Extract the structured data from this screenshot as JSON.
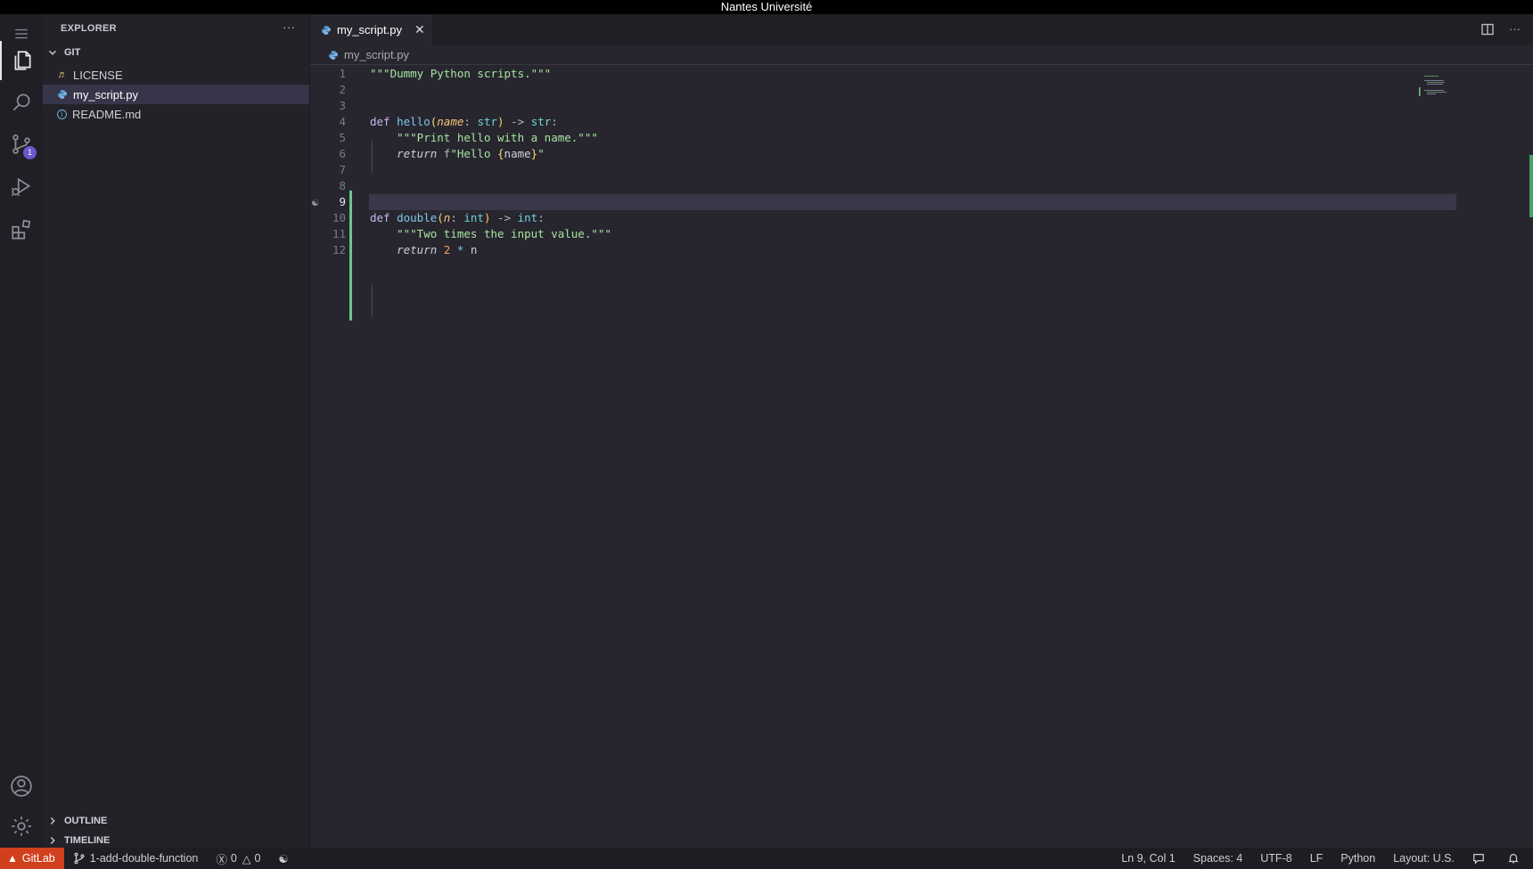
{
  "window": {
    "title": "Nantes Université"
  },
  "activity_bar": {
    "items": [
      {
        "name": "explorer",
        "icon": "files-icon"
      },
      {
        "name": "search",
        "icon": "search-icon"
      },
      {
        "name": "source-control",
        "icon": "source-control-icon",
        "badge": "1"
      },
      {
        "name": "run-debug",
        "icon": "run-debug-icon"
      },
      {
        "name": "extensions",
        "icon": "extensions-icon"
      }
    ]
  },
  "sidebar": {
    "title": "EXPLORER",
    "folder": "GIT",
    "files": [
      {
        "label": "LICENSE",
        "icon": "license-icon"
      },
      {
        "label": "my_script.py",
        "icon": "python-icon",
        "selected": true
      },
      {
        "label": "README.md",
        "icon": "info-icon"
      }
    ],
    "sections": [
      "OUTLINE",
      "TIMELINE"
    ]
  },
  "editor": {
    "tab": {
      "label": "my_script.py"
    },
    "breadcrumb": "my_script.py",
    "current_line": 9,
    "line_numbers": [
      "1",
      "2",
      "3",
      "4",
      "5",
      "6",
      "7",
      "8",
      "9",
      "10",
      "11",
      "12"
    ]
  },
  "statusbar": {
    "remote": "GitLab",
    "branch": "1-add-double-function",
    "errors": "0",
    "warnings": "0",
    "position": "Ln 9, Col 1",
    "spaces": "Spaces: 4",
    "encoding": "UTF-8",
    "eol": "LF",
    "language": "Python",
    "layout": "Layout: U.S."
  },
  "colors": {
    "accent": "#6e56cf",
    "gitlab": "#d0401d",
    "modified": "#6fc48e"
  }
}
